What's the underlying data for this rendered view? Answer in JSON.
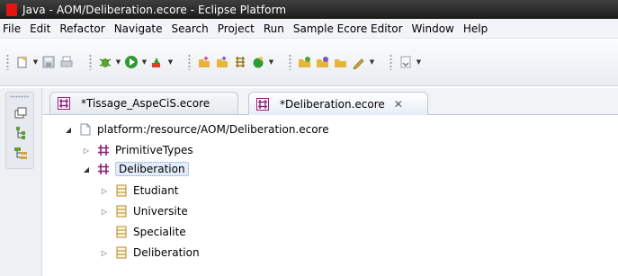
{
  "window": {
    "title": "Java - AOM/Deliberation.ecore - Eclipse Platform"
  },
  "menu": [
    "File",
    "Edit",
    "Refactor",
    "Navigate",
    "Search",
    "Project",
    "Run",
    "Sample Ecore Editor",
    "Window",
    "Help"
  ],
  "toolbar": {
    "buttons": [
      "new-icon",
      "save-icon",
      "print-icon",
      "debug-icon",
      "run-icon",
      "external-tools-icon",
      "new-java-project-icon",
      "new-package-icon",
      "new-class-icon",
      "new-icon-2",
      "open-type-icon",
      "open-task-icon",
      "open-resource-icon",
      "edit-icon",
      "next-annotation-icon"
    ]
  },
  "tabs": [
    {
      "label": "*Tissage_AspeCiS.ecore",
      "active": false
    },
    {
      "label": "*Deliberation.ecore",
      "active": true,
      "close": "✕"
    }
  ],
  "tree": {
    "root": "platform:/resource/AOM/Deliberation.ecore",
    "packages": [
      {
        "label": "PrimitiveTypes",
        "expanded": false
      },
      {
        "label": "Deliberation",
        "expanded": true,
        "selected": true,
        "classes": [
          {
            "label": "Etudiant",
            "expandable": true
          },
          {
            "label": "Universite",
            "expandable": true
          },
          {
            "label": "Specialite",
            "expandable": false
          },
          {
            "label": "Deliberation",
            "expandable": true
          }
        ]
      }
    ]
  },
  "colors": {
    "titlebar": "#2b2b2b",
    "package_icon": "#8a1f7a",
    "class_icon": "#c89a2a",
    "selection": "#e3ecfa"
  }
}
